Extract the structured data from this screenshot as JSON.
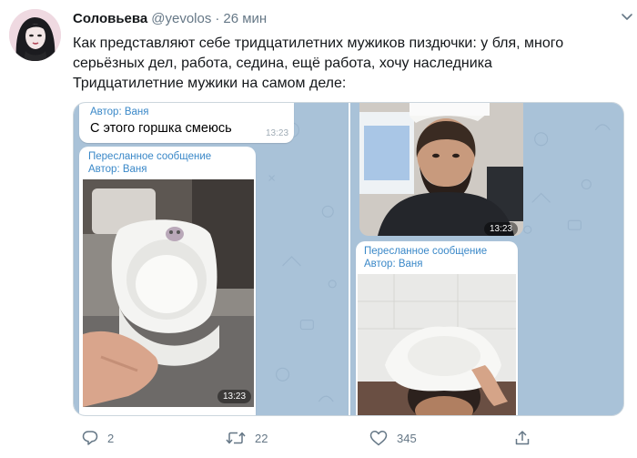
{
  "tweet": {
    "display_name": "Соловьева",
    "handle": "@yevolos",
    "separator": "·",
    "time": "26 мин",
    "text_lines": [
      "Как представляют себе тридцатилетних мужиков пиздючки: у бля, много",
      "серьёзных дел, работа, седина, ещё работа, хочу наследника",
      "Тридцатилетние мужики на самом деле:"
    ]
  },
  "media": {
    "left": {
      "top_bubble": {
        "author": "Автор: Ваня",
        "text": "С этого горшка смеюсь",
        "time": "13:23"
      },
      "photo_bubble": {
        "forwarded": "Пересланное сообщение",
        "author": "Автор: Ваня",
        "time": "13:23"
      }
    },
    "right": {
      "top_photo": {
        "time": "13:23"
      },
      "photo_bubble": {
        "forwarded": "Пересланное сообщение",
        "author": "Автор: Ваня"
      }
    }
  },
  "actions": {
    "reply_count": "2",
    "retweet_count": "22",
    "like_count": "345"
  },
  "colors": {
    "link_blue": "#3a88c8",
    "meta_gray": "#657786",
    "chat_bg": "#a6bfd6"
  },
  "icons": [
    "chevron-down-icon",
    "reply-icon",
    "retweet-icon",
    "like-icon",
    "share-icon"
  ]
}
